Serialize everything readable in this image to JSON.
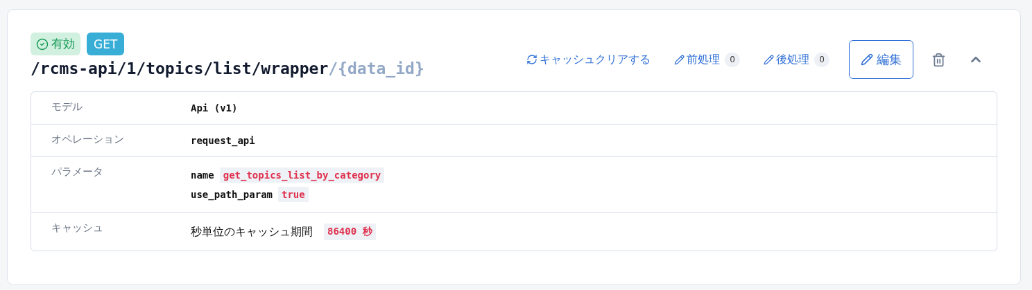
{
  "endpoint": {
    "status": "有効",
    "method": "GET",
    "path": "/rcms-api/1/topics/list/wrapper",
    "path_param": "/{data_id}"
  },
  "actions": {
    "cache_clear": "キャッシュクリアする",
    "pre_process": {
      "label": "前処理",
      "count": "0"
    },
    "post_process": {
      "label": "後処理",
      "count": "0"
    },
    "edit": "編集"
  },
  "details": [
    {
      "kind": "code",
      "label": "モデル",
      "value": "Api (v1)"
    },
    {
      "kind": "code",
      "label": "オペレーション",
      "value": "request_api"
    },
    {
      "kind": "params",
      "label": "パラメータ",
      "params": [
        {
          "name": "name",
          "value": "get_topics_list_by_category"
        },
        {
          "name": "use_path_param",
          "value": "true"
        }
      ]
    },
    {
      "kind": "cache",
      "label": "キャッシュ",
      "text": "秒単位のキャッシュ期間",
      "value": "86400 秒"
    }
  ]
}
